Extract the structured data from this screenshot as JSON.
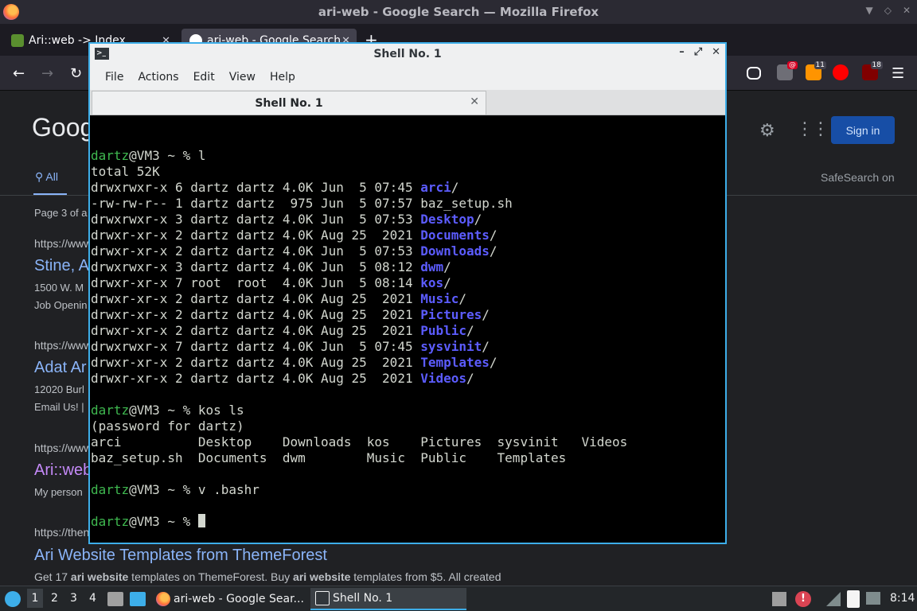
{
  "firefox": {
    "window_title": "ari-web - Google Search — Mozilla Firefox",
    "tabs": [
      {
        "label": "Ari::web -> Index"
      },
      {
        "label": "ari-web - Google Search"
      }
    ],
    "extensions": [
      {
        "name": "pocket-icon"
      },
      {
        "name": "extension-badge-icon",
        "badge": ""
      },
      {
        "name": "extension-orange-icon",
        "badge": "11"
      },
      {
        "name": "youtube-icon"
      },
      {
        "name": "ublock-icon",
        "badge": "18"
      }
    ]
  },
  "google": {
    "logo": "Goog",
    "signin_label": "Sign in",
    "tab_all_label": "All",
    "safesearch_label": "SafeSearch on",
    "page_info": "Page 3 of a",
    "results": [
      {
        "url": "https://www",
        "title": "Stine, A",
        "snippet_lines": [
          "1500 W. M",
          "Job Openin"
        ]
      },
      {
        "url": "https://www",
        "title": "Adat Ar",
        "snippet_lines": [
          "12020 Burl",
          "Email Us! |"
        ]
      },
      {
        "url": "https://www",
        "title": "Ari::web",
        "snippet_lines": [
          "My person"
        ]
      },
      {
        "url": "https://then",
        "title": "Ari Website Templates from ThemeForest",
        "snippet_lines": [
          "Get 17 ",
          "ari website",
          " templates on ThemeForest. Buy ",
          "ari website",
          " templates from $5. All created"
        ]
      }
    ]
  },
  "shell": {
    "window_title": "Shell No. 1",
    "menu": [
      "File",
      "Actions",
      "Edit",
      "View",
      "Help"
    ],
    "tab_label": "Shell No. 1",
    "lines": [
      {
        "parts": [
          {
            "t": "",
            "c": ""
          }
        ]
      },
      {
        "parts": [
          {
            "t": "dartz",
            "c": "usr"
          },
          {
            "t": "@VM3 ~ % l",
            "c": ""
          }
        ]
      },
      {
        "parts": [
          {
            "t": "total 52K",
            "c": ""
          }
        ]
      },
      {
        "parts": [
          {
            "t": "drwxrwxr-x 6 dartz dartz 4.0K Jun  5 07:45 ",
            "c": ""
          },
          {
            "t": "arci",
            "c": "dir"
          },
          {
            "t": "/",
            "c": ""
          }
        ]
      },
      {
        "parts": [
          {
            "t": "-rw-rw-r-- 1 dartz dartz  975 Jun  5 07:57 baz_setup.sh",
            "c": ""
          }
        ]
      },
      {
        "parts": [
          {
            "t": "drwxrwxr-x 3 dartz dartz 4.0K Jun  5 07:53 ",
            "c": ""
          },
          {
            "t": "Desktop",
            "c": "dir"
          },
          {
            "t": "/",
            "c": ""
          }
        ]
      },
      {
        "parts": [
          {
            "t": "drwxr-xr-x 2 dartz dartz 4.0K Aug 25  2021 ",
            "c": ""
          },
          {
            "t": "Documents",
            "c": "dir"
          },
          {
            "t": "/",
            "c": ""
          }
        ]
      },
      {
        "parts": [
          {
            "t": "drwxr-xr-x 2 dartz dartz 4.0K Jun  5 07:53 ",
            "c": ""
          },
          {
            "t": "Downloads",
            "c": "dir"
          },
          {
            "t": "/",
            "c": ""
          }
        ]
      },
      {
        "parts": [
          {
            "t": "drwxrwxr-x 3 dartz dartz 4.0K Jun  5 08:12 ",
            "c": ""
          },
          {
            "t": "dwm",
            "c": "dir"
          },
          {
            "t": "/",
            "c": ""
          }
        ]
      },
      {
        "parts": [
          {
            "t": "drwxr-xr-x 7 root  root  4.0K Jun  5 08:14 ",
            "c": ""
          },
          {
            "t": "kos",
            "c": "dir"
          },
          {
            "t": "/",
            "c": ""
          }
        ]
      },
      {
        "parts": [
          {
            "t": "drwxr-xr-x 2 dartz dartz 4.0K Aug 25  2021 ",
            "c": ""
          },
          {
            "t": "Music",
            "c": "dir"
          },
          {
            "t": "/",
            "c": ""
          }
        ]
      },
      {
        "parts": [
          {
            "t": "drwxr-xr-x 2 dartz dartz 4.0K Aug 25  2021 ",
            "c": ""
          },
          {
            "t": "Pictures",
            "c": "dir"
          },
          {
            "t": "/",
            "c": ""
          }
        ]
      },
      {
        "parts": [
          {
            "t": "drwxr-xr-x 2 dartz dartz 4.0K Aug 25  2021 ",
            "c": ""
          },
          {
            "t": "Public",
            "c": "dir"
          },
          {
            "t": "/",
            "c": ""
          }
        ]
      },
      {
        "parts": [
          {
            "t": "drwxrwxr-x 7 dartz dartz 4.0K Jun  5 07:45 ",
            "c": ""
          },
          {
            "t": "sysvinit",
            "c": "dir"
          },
          {
            "t": "/",
            "c": ""
          }
        ]
      },
      {
        "parts": [
          {
            "t": "drwxr-xr-x 2 dartz dartz 4.0K Aug 25  2021 ",
            "c": ""
          },
          {
            "t": "Templates",
            "c": "dir"
          },
          {
            "t": "/",
            "c": ""
          }
        ]
      },
      {
        "parts": [
          {
            "t": "drwxr-xr-x 2 dartz dartz 4.0K Aug 25  2021 ",
            "c": ""
          },
          {
            "t": "Videos",
            "c": "dir"
          },
          {
            "t": "/",
            "c": ""
          }
        ]
      },
      {
        "parts": [
          {
            "t": "",
            "c": ""
          }
        ]
      },
      {
        "parts": [
          {
            "t": "dartz",
            "c": "usr"
          },
          {
            "t": "@VM3 ~ % kos ls",
            "c": ""
          }
        ]
      },
      {
        "parts": [
          {
            "t": "(password for dartz)",
            "c": ""
          }
        ]
      },
      {
        "parts": [
          {
            "t": "arci          Desktop    Downloads  kos    Pictures  sysvinit   Videos",
            "c": ""
          }
        ]
      },
      {
        "parts": [
          {
            "t": "baz_setup.sh  Documents  dwm        Music  Public    Templates",
            "c": ""
          }
        ]
      },
      {
        "parts": [
          {
            "t": "",
            "c": ""
          }
        ]
      },
      {
        "parts": [
          {
            "t": "dartz",
            "c": "usr"
          },
          {
            "t": "@VM3 ~ % v .bashr",
            "c": ""
          }
        ]
      },
      {
        "parts": [
          {
            "t": "",
            "c": ""
          }
        ]
      },
      {
        "parts": [
          {
            "t": "dartz",
            "c": "usr"
          },
          {
            "t": "@VM3 ~ % ",
            "c": ""
          },
          {
            "t": "",
            "c": "cursor"
          }
        ]
      }
    ]
  },
  "taskbar": {
    "workspaces": [
      "1",
      "2",
      "3",
      "4"
    ],
    "tasks": [
      {
        "label": "ari-web - Google Sear..."
      },
      {
        "label": "Shell No. 1"
      }
    ],
    "tray_alert": "!",
    "clock": "8:14"
  }
}
